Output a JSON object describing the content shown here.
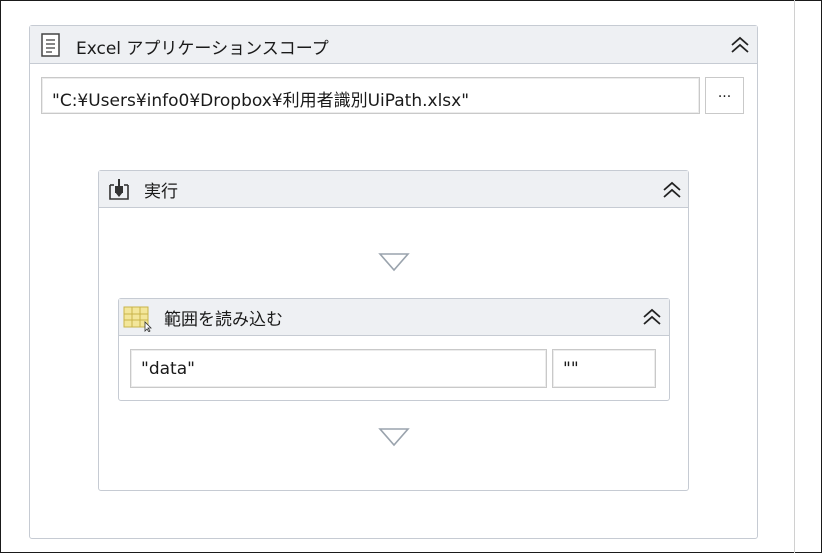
{
  "excel_scope": {
    "title": "Excel アプリケーションスコープ",
    "icon": "excel-document-icon",
    "collapse_icon": "double-chevron-up-icon",
    "workbook_path": "\"C:¥Users¥info0¥Dropbox¥利用者識別UiPath.xlsx\"",
    "browse_label": "..."
  },
  "execute": {
    "title": "実行",
    "icon": "execute-activity-icon",
    "collapse_icon": "double-chevron-up-icon"
  },
  "read_range": {
    "title": "範囲を読み込む",
    "icon": "read-range-icon",
    "collapse_icon": "double-chevron-up-icon",
    "sheet_name": "\"data\"",
    "range": "\"\""
  },
  "colors": {
    "header_bg": "#eef0f3",
    "border": "#c6cbd3",
    "drop_arrow": "#9aa3ad"
  }
}
